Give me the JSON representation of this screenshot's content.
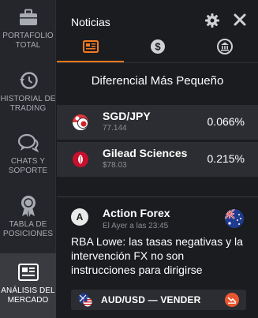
{
  "sidebar": {
    "items": [
      {
        "label": "PORTAFOLIO\nTOTAL",
        "icon": "briefcase-icon"
      },
      {
        "label": "HISTORIAL DE\nTRADING",
        "icon": "history-icon"
      },
      {
        "label": "CHATS Y\nSOPORTE",
        "icon": "chat-icon"
      },
      {
        "label": "TABLA DE\nPOSICIONES",
        "icon": "award-icon"
      },
      {
        "label": "ANÁLISIS DEL\nMERCADO",
        "icon": "newspaper-icon",
        "active": true
      }
    ]
  },
  "header": {
    "title": "Noticias"
  },
  "tabs": [
    {
      "icon": "newspaper-icon",
      "active": true
    },
    {
      "icon": "dollar-icon"
    },
    {
      "icon": "bank-icon"
    }
  ],
  "section": {
    "title": "Diferencial Más Pequeño"
  },
  "assets": [
    {
      "name": "SGD/JPY",
      "sub": "77.144",
      "pct": "0.066%"
    },
    {
      "name": "Gilead Sciences",
      "sub": "$78.03",
      "pct": "0.215%"
    }
  ],
  "news": {
    "logo_letter": "A",
    "source": "Action Forex",
    "time": "El Ayer a las 23:45",
    "body": "RBA Lowe: las tasas negativas y la intervención FX no son instrucciones para dirigirse",
    "trade_label": "AUD/USD — VENDER"
  },
  "colors": {
    "accent": "#f47a1f",
    "background": "#1b1c20",
    "sidebar": "#25262b",
    "row": "#2c2d32"
  }
}
